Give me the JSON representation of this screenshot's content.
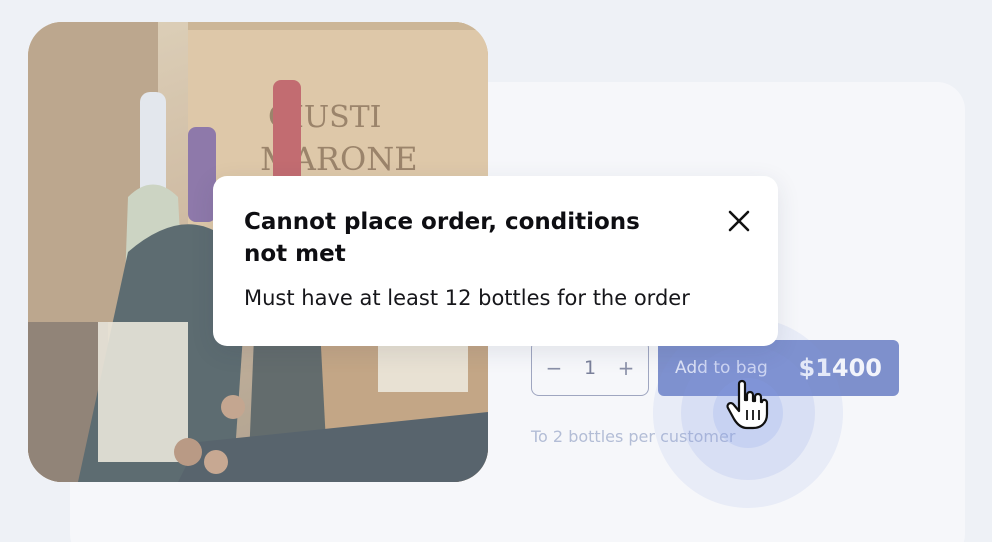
{
  "toast": {
    "title": "Cannot place order, conditions not met",
    "message": "Must have at least 12 bottles for the order",
    "close_icon": "close-icon"
  },
  "product": {
    "image_label_1": "GIUSTI",
    "image_label_2": "MARONE",
    "quantity": "1",
    "decrement_label": "−",
    "increment_label": "+",
    "add_to_bag_label": "Add to bag",
    "price": "$1400",
    "limit_note": "To 2 bottles per customer"
  },
  "colors": {
    "accent": "#7e90cc",
    "background": "#eef1f6"
  }
}
